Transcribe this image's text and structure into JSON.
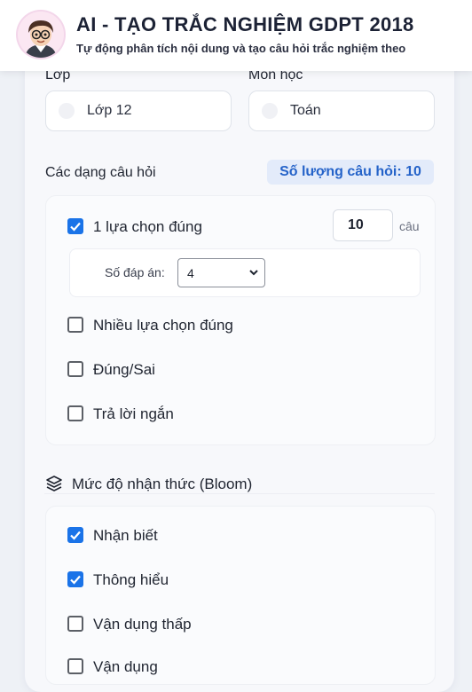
{
  "header": {
    "title": "AI - TẠO TRẮC NGHIỆM GDPT 2018",
    "subtitle": "Tự động phân tích nội dung và tạo câu hỏi trắc nghiệm theo"
  },
  "form": {
    "grade_label": "Lớp",
    "grade_value": "Lớp 12",
    "subject_label": "Môn học",
    "subject_value": "Toán"
  },
  "question_types": {
    "heading": "Các dạng câu hỏi",
    "count_badge": "Số lượng câu hỏi: 10",
    "items": [
      {
        "label": "1 lựa chọn đúng",
        "checked": true
      },
      {
        "label": "Nhiều lựa chọn đúng",
        "checked": false
      },
      {
        "label": "Đúng/Sai",
        "checked": false
      },
      {
        "label": "Trả lời ngắn",
        "checked": false
      }
    ],
    "quantity_value": "10",
    "quantity_unit": "câu",
    "answers_label": "Số đáp án:",
    "answers_value": "4"
  },
  "bloom": {
    "heading": "Mức độ nhận thức (Bloom)",
    "items": [
      {
        "label": "Nhận biết",
        "checked": true
      },
      {
        "label": "Thông hiểu",
        "checked": true
      },
      {
        "label": "Vận dụng thấp",
        "checked": false
      },
      {
        "label": "Vận dụng",
        "checked": false
      }
    ]
  },
  "colors": {
    "accent": "#1a73e8",
    "badge_text": "#2563c9",
    "badge_bg": "#e3ebfa"
  }
}
